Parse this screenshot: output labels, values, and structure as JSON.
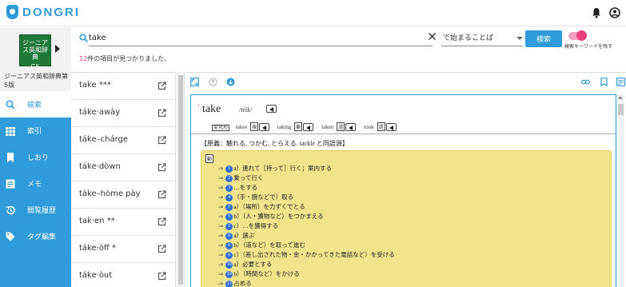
{
  "app": {
    "logo_text": "DONGRI"
  },
  "header": {
    "icons": [
      "bell-icon",
      "account-icon"
    ]
  },
  "sidebar": {
    "book": {
      "cover_text": "ジーニアス英和辞典",
      "edition_tag": "G5",
      "name": "ジーニアス英和辞典第5版"
    },
    "items": [
      {
        "label": "検索",
        "icon": "search-icon",
        "active": true
      },
      {
        "label": "索引",
        "icon": "grid-icon",
        "active": false
      },
      {
        "label": "しおり",
        "icon": "bookmark-icon",
        "active": false
      },
      {
        "label": "メモ",
        "icon": "memo-icon",
        "active": false
      },
      {
        "label": "閲覧履歴",
        "icon": "history-icon",
        "active": false
      },
      {
        "label": "タグ編集",
        "icon": "tag-icon",
        "active": false
      }
    ]
  },
  "search": {
    "value": "take",
    "mode": "で始まることば",
    "button_label": "検索",
    "toggle_label": "検索キーワードを残す",
    "result_count": "12",
    "result_suffix": "件の項目が見つかりました。"
  },
  "word_list": [
    "take ***",
    "táke·awày",
    "táke–chárge",
    "táke·dòwn",
    "táke–hòme pày",
    "tak·en **",
    "táke·òff *",
    "táke·òut"
  ],
  "entry": {
    "headword": "take",
    "headword_mark": "¹",
    "pronunciation": "/téik/",
    "forms_tag": "変化形",
    "forms": [
      {
        "word": "takes",
        "tag": "現"
      },
      {
        "word": "taking",
        "tag": "動"
      },
      {
        "word": "taken",
        "tag": "過"
      },
      {
        "word": "took",
        "tag": "過"
      }
    ],
    "etymology": "【原義：触れる, つかむ, とらえる. tackle と同語源】",
    "pos": "動",
    "senses": [
      {
        "num": "1",
        "text": "a）連れて［持って］行く；案内する"
      },
      {
        "num": "2",
        "text": "乗って行く"
      },
      {
        "num": "3",
        "text": "…をする"
      },
      {
        "num": "4",
        "text": "（手・腕などで）取る"
      },
      {
        "num": "5",
        "text": "a）（場所）を力ずくでとる"
      },
      {
        "num": "5",
        "text": "b）（人・獲物など）をつかまえる"
      },
      {
        "num": "5",
        "text": "c）…を獲得する"
      },
      {
        "num": "6",
        "text": "a）選ぶ"
      },
      {
        "num": "6",
        "text": "b）（道など）を取って進む"
      },
      {
        "num": "6",
        "text": "c）（差し出された物・金・かかってきた電話など）を受ける"
      },
      {
        "num": "10",
        "text": "a）必要とする"
      },
      {
        "num": "10",
        "text": "b）（時間など）をかける"
      },
      {
        "num": "11",
        "text": "占める"
      }
    ]
  }
}
